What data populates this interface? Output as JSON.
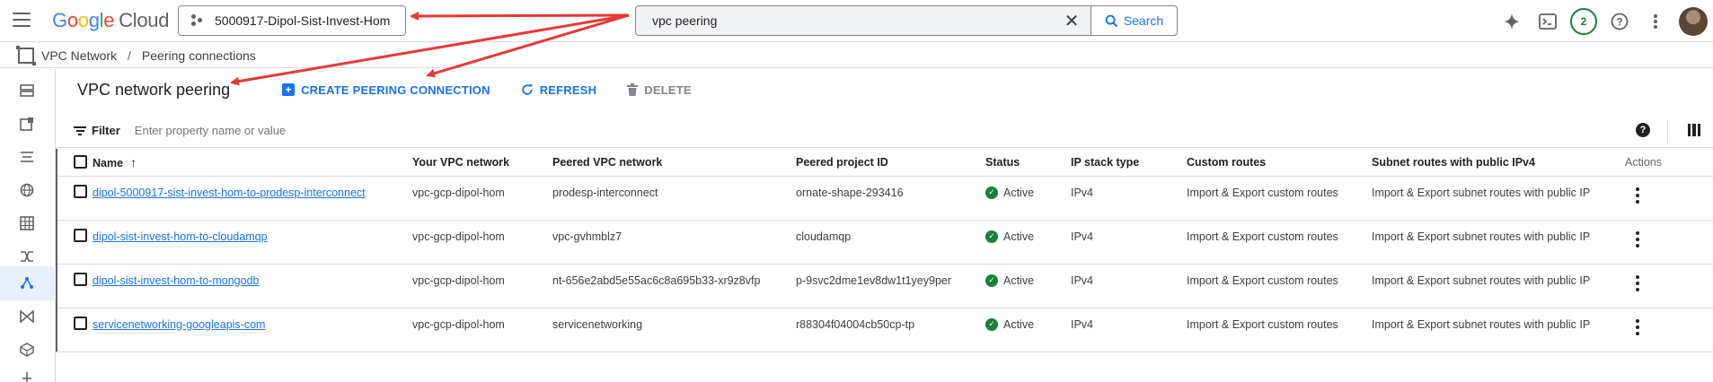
{
  "topbar": {
    "logo": {
      "g1": "G",
      "g2": "o",
      "g3": "o",
      "g4": "g",
      "g5": "l",
      "g6": "e",
      "product": "Cloud"
    },
    "project": "5000917-Dipol-Sist-Invest-Hom",
    "search": {
      "value": "vpc peering",
      "button_label": "Search"
    },
    "notification_count": "2"
  },
  "breadcrumb": {
    "root": "VPC Network",
    "separator": "/",
    "current": "Peering connections"
  },
  "page": {
    "title": "VPC network peering",
    "actions": {
      "create": "CREATE PEERING CONNECTION",
      "refresh": "REFRESH",
      "delete": "DELETE"
    }
  },
  "filter": {
    "label": "Filter",
    "placeholder": "Enter property name or value"
  },
  "table": {
    "headers": {
      "name": "Name",
      "vpc": "Your VPC network",
      "peered_vpc": "Peered VPC network",
      "project": "Peered project ID",
      "status": "Status",
      "ip": "IP stack type",
      "custom": "Custom routes",
      "subnet": "Subnet routes with public IPv4",
      "actions": "Actions"
    },
    "rows": [
      {
        "name": "dipol-5000917-sist-invest-hom-to-prodesp-interconnect",
        "vpc": "vpc-gcp-dipol-hom",
        "peered_vpc": "prodesp-interconnect",
        "project": "ornate-shape-293416",
        "status": "Active",
        "ip": "IPv4",
        "custom": "Import & Export custom routes",
        "subnet": "Import & Export subnet routes with public IP"
      },
      {
        "name": "dipol-sist-invest-hom-to-cloudamqp",
        "vpc": "vpc-gcp-dipol-hom",
        "peered_vpc": "vpc-gvhmblz7",
        "project": "cloudamqp",
        "status": "Active",
        "ip": "IPv4",
        "custom": "Import & Export custom routes",
        "subnet": "Import & Export subnet routes with public IP"
      },
      {
        "name": "dipol-sist-invest-hom-to-mongodb",
        "vpc": "vpc-gcp-dipol-hom",
        "peered_vpc": "nt-656e2abd5e55ac6c8a695b33-xr9z8vfp",
        "project": "p-9svc2dme1ev8dw1t1yey9per",
        "status": "Active",
        "ip": "IPv4",
        "custom": "Import & Export custom routes",
        "subnet": "Import & Export subnet routes with public IP"
      },
      {
        "name": "servicenetworking-googleapis-com",
        "vpc": "vpc-gcp-dipol-hom",
        "peered_vpc": "servicenetworking",
        "project": "r88304f04004cb50cp-tp",
        "status": "Active",
        "ip": "IPv4",
        "custom": "Import & Export custom routes",
        "subnet": "Import & Export subnet routes with public IP"
      }
    ]
  },
  "colors": {
    "accent": "#1a73e8",
    "success": "#188038",
    "annotation": "#e53935"
  }
}
